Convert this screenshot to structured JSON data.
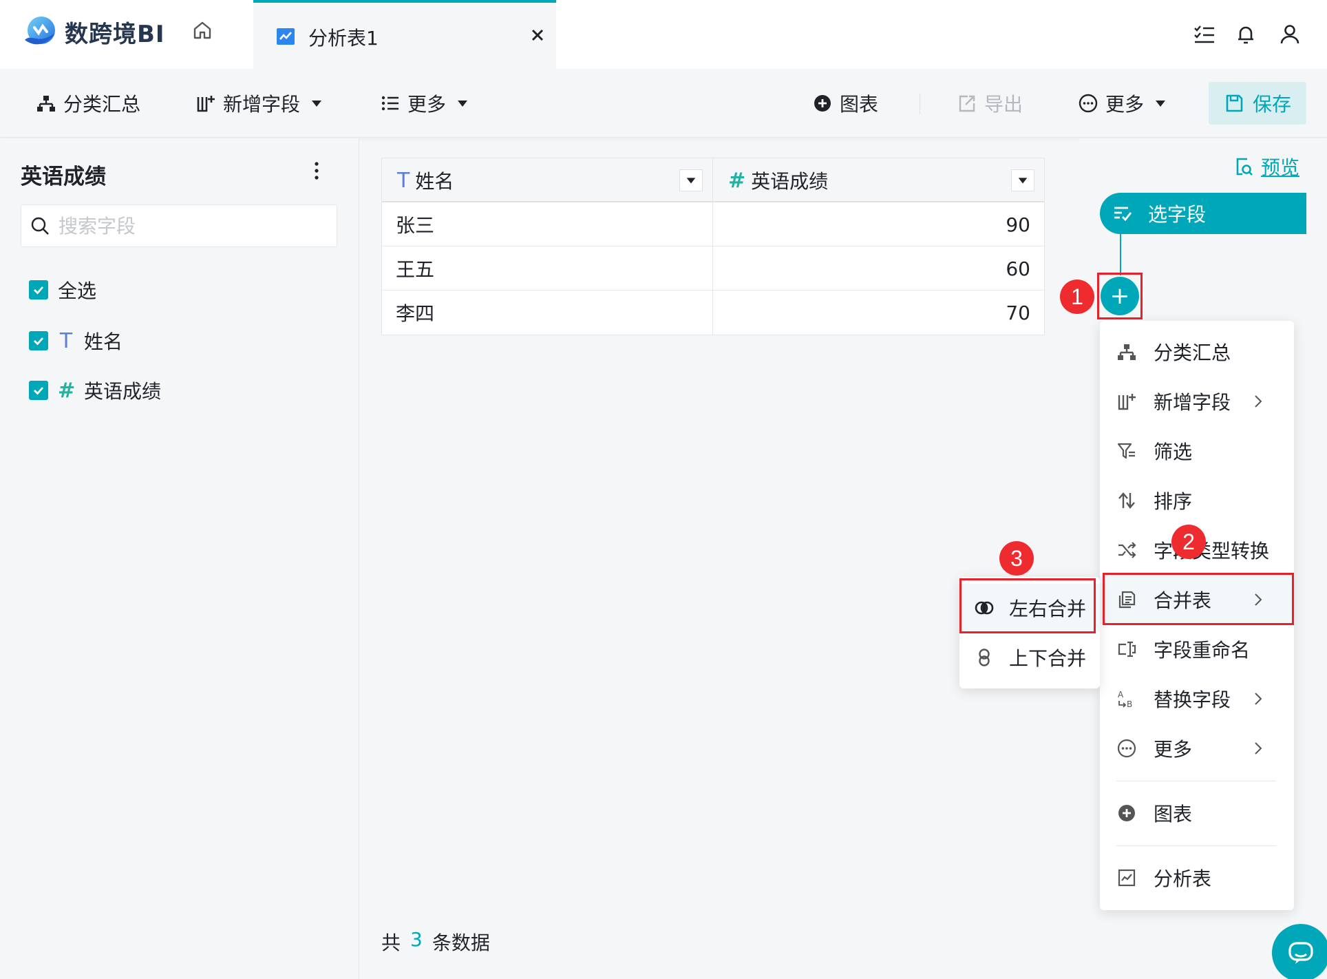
{
  "app": {
    "logo_text": "数跨境BI"
  },
  "tabs": [
    {
      "label": "分析表1"
    }
  ],
  "toolbar": {
    "group_summary": "分类汇总",
    "add_field": "新增字段",
    "more_left": "更多",
    "chart": "图表",
    "export": "导出",
    "more_right": "更多",
    "save": "保存"
  },
  "left_panel": {
    "title": "英语成绩",
    "search_placeholder": "搜索字段",
    "select_all": "全选",
    "fields": [
      {
        "type": "T",
        "name": "姓名"
      },
      {
        "type": "#",
        "name": "英语成绩"
      }
    ]
  },
  "table": {
    "columns": [
      {
        "type": "T",
        "name": "姓名"
      },
      {
        "type": "#",
        "name": "英语成绩"
      }
    ],
    "rows": [
      [
        "张三",
        "90"
      ],
      [
        "王五",
        "60"
      ],
      [
        "李四",
        "70"
      ]
    ],
    "footer": {
      "prefix": "共",
      "count": "3",
      "suffix": "条数据"
    }
  },
  "flow": {
    "preview": "预览",
    "step_select": "选字段",
    "add": "+"
  },
  "menu": {
    "items": [
      {
        "label": "分类汇总",
        "icon": "hierarchy-icon"
      },
      {
        "label": "新增字段",
        "icon": "add-column-icon",
        "submenu": true
      },
      {
        "label": "筛选",
        "icon": "filter-icon"
      },
      {
        "label": "排序",
        "icon": "sort-icon"
      },
      {
        "label": "字段类型转换",
        "icon": "shuffle-icon"
      },
      {
        "label": "合并表",
        "icon": "merge-table-icon",
        "submenu": true
      },
      {
        "label": "字段重命名",
        "icon": "rename-icon"
      },
      {
        "label": "替换字段",
        "icon": "replace-icon",
        "submenu": true
      },
      {
        "label": "更多",
        "icon": "more-circle-icon",
        "submenu": true
      },
      {
        "label": "图表",
        "icon": "plus-circle-icon"
      },
      {
        "label": "分析表",
        "icon": "analysis-table-icon"
      }
    ]
  },
  "submenu": {
    "items": [
      {
        "label": "左右合并",
        "icon": "horizontal-merge-icon"
      },
      {
        "label": "上下合并",
        "icon": "vertical-merge-icon"
      }
    ]
  },
  "annotations": [
    "1",
    "2",
    "3"
  ],
  "colors": {
    "accent": "#00a7b8",
    "highlight": "#e8202a",
    "badge": "#ee2b2f"
  }
}
